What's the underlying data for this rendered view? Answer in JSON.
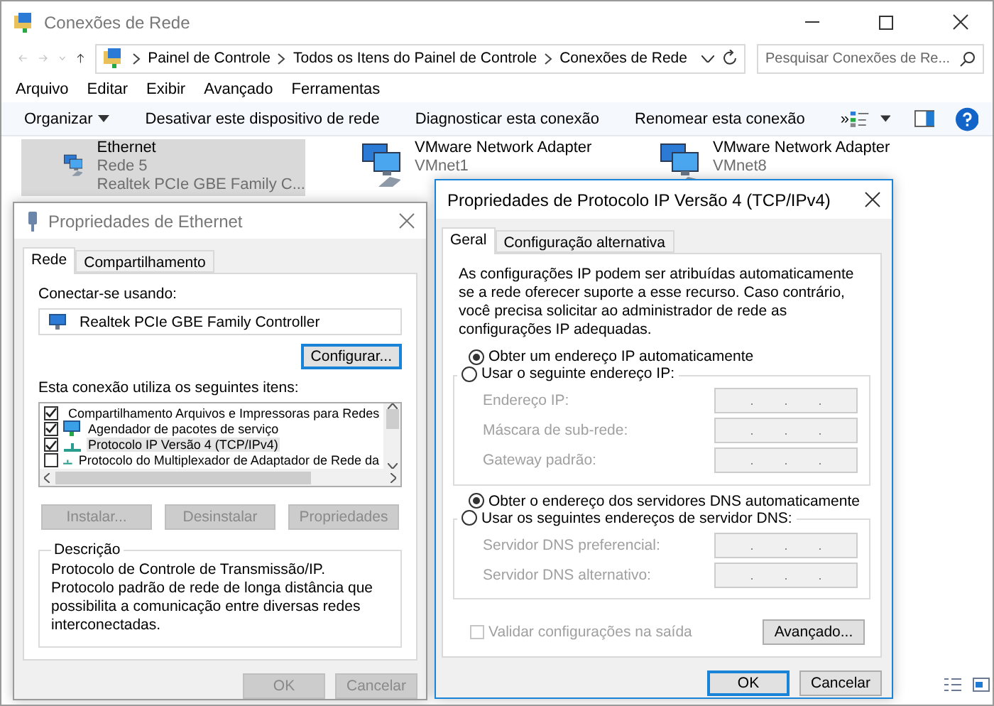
{
  "explorer": {
    "title": "Conexões de Rede",
    "breadcrumb": [
      "Painel de Controle",
      "Todos os Itens do Painel de Controle",
      "Conexões de Rede"
    ],
    "search": {
      "placeholder": "Pesquisar Conexões de Re..."
    },
    "menu": [
      "Arquivo",
      "Editar",
      "Exibir",
      "Avançado",
      "Ferramentas"
    ],
    "toolbar": [
      {
        "label": "Organizar",
        "kind": "dropdown"
      },
      {
        "label": "Desativar este dispositivo de rede",
        "kind": "command"
      },
      {
        "label": "Diagnosticar esta conexão",
        "kind": "command"
      },
      {
        "label": "Renomear esta conexão",
        "kind": "command"
      },
      {
        "label": "»",
        "kind": "more"
      }
    ],
    "connections": [
      {
        "name": "Ethernet",
        "lines": [
          "Rede 5",
          "Realtek PCIe GBE Family C..."
        ],
        "selected": true
      },
      {
        "name": "VMware Network Adapter",
        "lines": [
          "VMnet1"
        ],
        "selected": false
      },
      {
        "name": "VMware Network Adapter",
        "lines": [
          "VMnet8"
        ],
        "selected": false
      }
    ]
  },
  "ethernet_dialog": {
    "title": "Propriedades de Ethernet",
    "tabs": [
      {
        "label": "Rede",
        "selected": true
      },
      {
        "label": "Compartilhamento",
        "selected": false
      }
    ],
    "connect_label": "Conectar-se usando:",
    "adapter": "Realtek PCIe GBE Family Controller",
    "configure_button": "Configurar...",
    "items_label": "Esta conexão utiliza os seguintes itens:",
    "items": [
      {
        "label": "Compartilhamento Arquivos e Impressoras para Redes",
        "checked": true,
        "kind": "service",
        "selected": false
      },
      {
        "label": "Agendador de pacotes de serviço",
        "checked": true,
        "kind": "service",
        "selected": false
      },
      {
        "label": "Protocolo IP Versão 4 (TCP/IPv4)",
        "checked": true,
        "kind": "protocol",
        "selected": true
      },
      {
        "label": "Protocolo do Multiplexador de Adaptador de Rede da",
        "checked": false,
        "kind": "protocol",
        "selected": false
      }
    ],
    "actions": [
      {
        "label": "Instalar...",
        "disabled": true
      },
      {
        "label": "Desinstalar",
        "disabled": true
      },
      {
        "label": "Propriedades",
        "disabled": true
      }
    ],
    "description": {
      "legend": "Descrição",
      "text": "Protocolo de Controle de Transmissão/IP. Protocolo padrão de rede de longa distância que possibilita a comunicação entre diversas redes interconectadas."
    },
    "buttons": [
      {
        "label": "OK",
        "disabled": true
      },
      {
        "label": "Cancelar",
        "disabled": true
      }
    ]
  },
  "ipv4_dialog": {
    "title": "Propriedades de Protocolo IP Versão 4 (TCP/IPv4)",
    "tabs": [
      {
        "label": "Geral",
        "selected": true
      },
      {
        "label": "Configuração alternativa",
        "selected": false
      }
    ],
    "intro": "As configurações IP podem ser atribuídas automaticamente se a rede oferecer suporte a esse recurso. Caso contrário, você precisa solicitar ao administrador de rede as configurações IP adequadas.",
    "ip_auto": {
      "label": "Obter um endereço IP automaticamente",
      "selected": true
    },
    "ip_manual": {
      "label": "Usar o seguinte endereço IP:",
      "selected": false
    },
    "ip_fields": [
      {
        "label": "Endereço IP:",
        "disabled": true
      },
      {
        "label": "Máscara de sub-rede:",
        "disabled": true
      },
      {
        "label": "Gateway padrão:",
        "disabled": true
      }
    ],
    "dns_auto": {
      "label": "Obter o endereço dos servidores DNS automaticamente",
      "selected": true
    },
    "dns_manual": {
      "label": "Usar os seguintes endereços de servidor DNS:",
      "selected": false
    },
    "dns_fields": [
      {
        "label": "Servidor DNS preferencial:",
        "disabled": true
      },
      {
        "label": "Servidor DNS alternativo:",
        "disabled": true
      }
    ],
    "validate": {
      "label": "Validar configurações na saída",
      "checked": false,
      "disabled": true
    },
    "advanced_button": "Avançado...",
    "buttons": [
      {
        "label": "OK",
        "default": true
      },
      {
        "label": "Cancelar",
        "default": false
      }
    ]
  }
}
